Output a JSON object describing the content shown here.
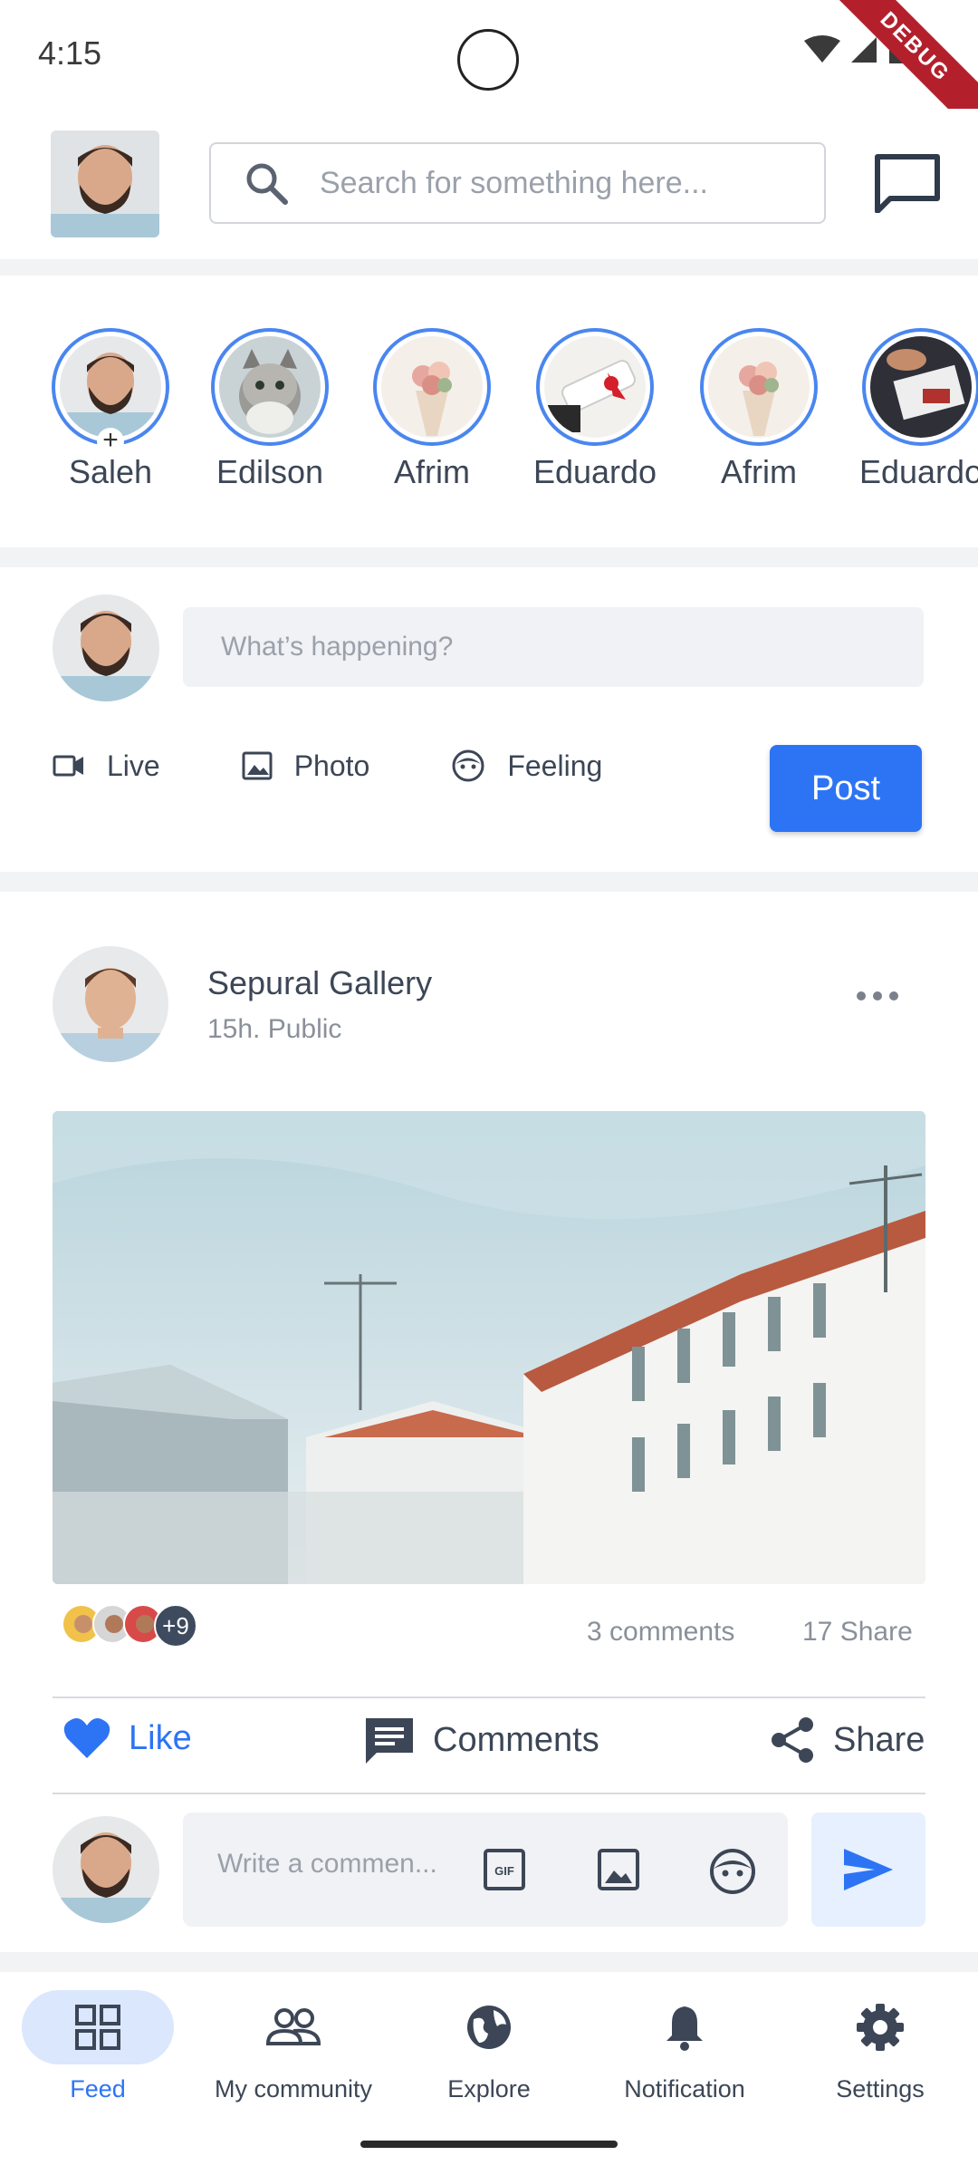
{
  "status_bar": {
    "time": "4:15",
    "debug_label": "DEBUG"
  },
  "header": {
    "search_placeholder": "Search for something here...",
    "icons": {
      "search": "search-icon",
      "messages": "chat-bubble-icon"
    }
  },
  "stories": [
    {
      "name": "Saleh",
      "self": true
    },
    {
      "name": "Edilson"
    },
    {
      "name": "Afrim"
    },
    {
      "name": "Eduardo"
    },
    {
      "name": "Afrim"
    },
    {
      "name": "Eduardo"
    }
  ],
  "composer": {
    "placeholder": "What’s happening?",
    "actions": {
      "live": "Live",
      "photo": "Photo",
      "feeling": "Feeling"
    },
    "post_label": "Post"
  },
  "post": {
    "author": "Sepural Gallery",
    "meta": "15h. Public",
    "reactions_more": "+9",
    "comments_count": "3 comments",
    "share_count": "17 Share",
    "like_label": "Like",
    "comments_label": "Comments",
    "share_label": "Share",
    "comment_placeholder": "Write a commen..."
  },
  "nav": {
    "feed": "Feed",
    "community": "My community",
    "explore": "Explore",
    "notification": "Notification",
    "settings": "Settings",
    "active": "feed"
  },
  "colors": {
    "accent": "#2d74f5",
    "story_ring": "#4a86f0",
    "text": "#3c4656",
    "muted": "#8a909a"
  }
}
